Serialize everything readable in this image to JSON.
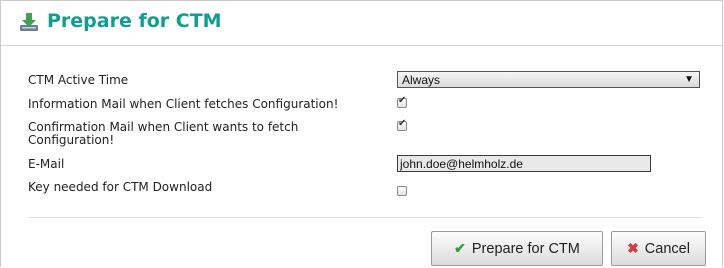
{
  "header": {
    "title": "Prepare for CTM",
    "icon": "download-icon"
  },
  "form": {
    "active_time_label": "CTM Active Time",
    "active_time_value": "Always",
    "info_mail_label": "Information Mail when Client fetches Configuration!",
    "info_mail_checked": true,
    "confirm_mail_label_line1": "Confirmation Mail when Client wants to fetch",
    "confirm_mail_label_line2": "Configuration!",
    "confirm_mail_checked": true,
    "email_label": "E-Mail",
    "email_value": "john.doe@helmholz.de",
    "key_label": "Key needed for CTM Download",
    "key_checked": false
  },
  "buttons": {
    "prepare_label": "Prepare for CTM",
    "cancel_label": "Cancel"
  },
  "colors": {
    "title": "#0f9e8f",
    "ok_icon": "#2e9d3a",
    "cancel_icon": "#d23b3b"
  }
}
